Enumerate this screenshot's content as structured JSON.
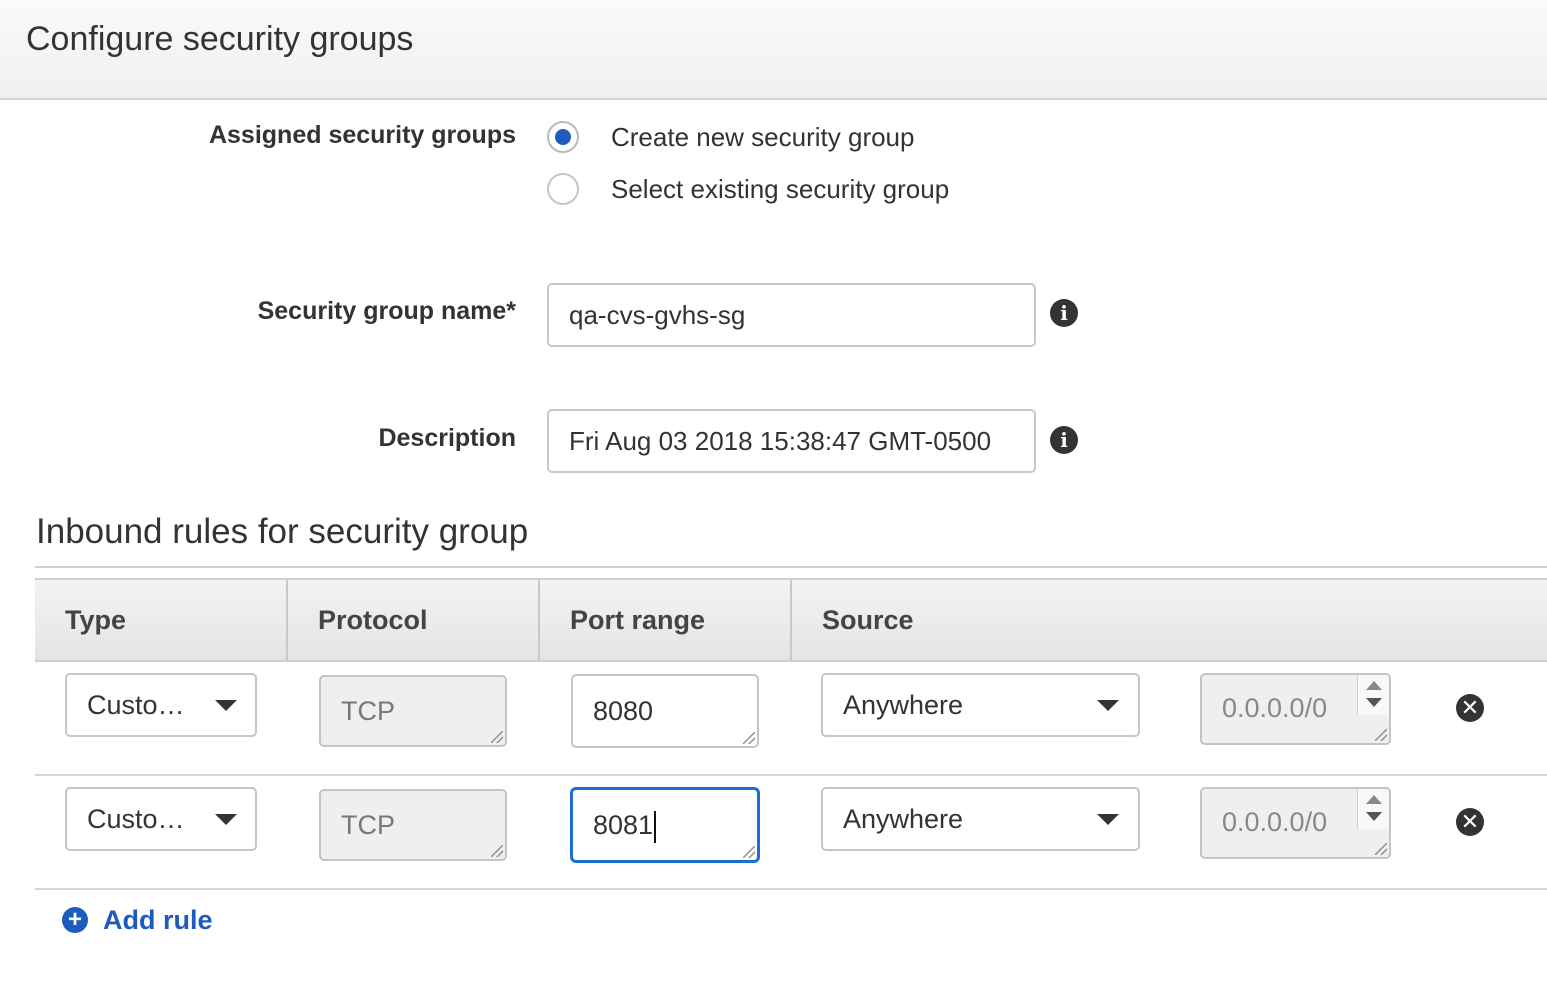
{
  "header": {
    "title": "Configure security groups"
  },
  "assigned": {
    "label": "Assigned security groups",
    "options": [
      {
        "label": "Create new security group",
        "checked": true
      },
      {
        "label": "Select existing security group",
        "checked": false
      }
    ]
  },
  "group_name": {
    "label": "Security group name*",
    "value": "qa-cvs-gvhs-sg"
  },
  "description": {
    "label": "Description",
    "value": "Fri Aug 03 2018 15:38:47 GMT-0500"
  },
  "info_icon_glyph": "i",
  "inbound": {
    "title": "Inbound rules for security group",
    "columns": [
      "Type",
      "Protocol",
      "Port range",
      "Source"
    ],
    "rules": [
      {
        "type": "Custo…",
        "protocol": "TCP",
        "port": "8080",
        "source": "Anywhere",
        "cidr": "0.0.0.0/0",
        "focused": false
      },
      {
        "type": "Custo…",
        "protocol": "TCP",
        "port": "8081",
        "source": "Anywhere",
        "cidr": "0.0.0.0/0",
        "focused": true
      }
    ],
    "remove_glyph": "✕",
    "add_rule": {
      "icon": "+",
      "label": "Add rule"
    }
  },
  "colors": {
    "accent": "#1f5bbf",
    "focus": "#1a6fd1",
    "text": "#333333"
  }
}
